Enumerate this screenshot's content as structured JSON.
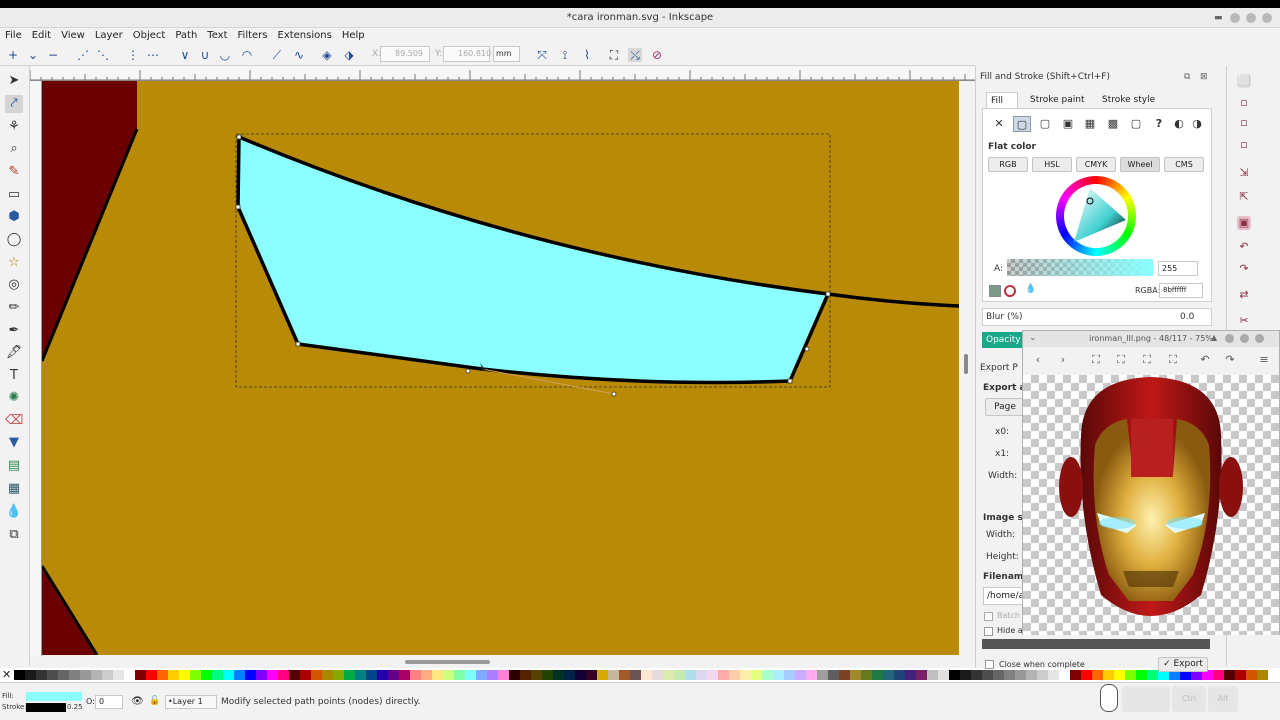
{
  "window": {
    "title": "*cara ironman.svg - Inkscape"
  },
  "menu": [
    "File",
    "Edit",
    "View",
    "Layer",
    "Object",
    "Path",
    "Text",
    "Filters",
    "Extensions",
    "Help"
  ],
  "controls": {
    "x_label": "X:",
    "x_value": "89.509",
    "y_label": "Y:",
    "y_value": "160.810",
    "unit": "mm"
  },
  "dock": {
    "title": "Fill and Stroke (Shift+Ctrl+F)",
    "tabs": [
      "Fill",
      "Stroke paint",
      "Stroke style"
    ],
    "flat_color": "Flat color",
    "modes": [
      "RGB",
      "HSL",
      "CMYK",
      "Wheel",
      "CMS"
    ],
    "alpha_label": "A:",
    "alpha_value": "255",
    "rgba_label": "RGBA:",
    "rgba_value": "8bffffff",
    "blur_label": "Blur (%)",
    "blur_value": "0.0",
    "opacity_label": "Opacity (",
    "export_title": "Export P",
    "export_area": "Export ar",
    "page_btn": "Page",
    "x0": "x0:",
    "x1": "x1:",
    "width": "Width:",
    "image_size": "Image siz",
    "img_width": "Width:",
    "height": "Height:",
    "filename": "Filename",
    "filename_value": "/home/a",
    "batch": "Batch",
    "hide": "Hide a",
    "close_when_complete": "Close when complete",
    "export_btn": "Export"
  },
  "viewer": {
    "title": "ironman_III.png - 48/117 - 75%"
  },
  "status": {
    "fill_label": "Fill:",
    "stroke_label": "Stroke:",
    "stroke_width": "0.25",
    "opacity_label": "O:",
    "opacity_value": "0",
    "layer": "•Layer 1",
    "message": "Modify selected path points (nodes) directly.",
    "key_ctrl": "Ctrl",
    "key_alt": "Alt"
  },
  "colors": {
    "canvas": "#b88a05",
    "fill": "#8bffff",
    "dark_red": "#6b0000"
  }
}
